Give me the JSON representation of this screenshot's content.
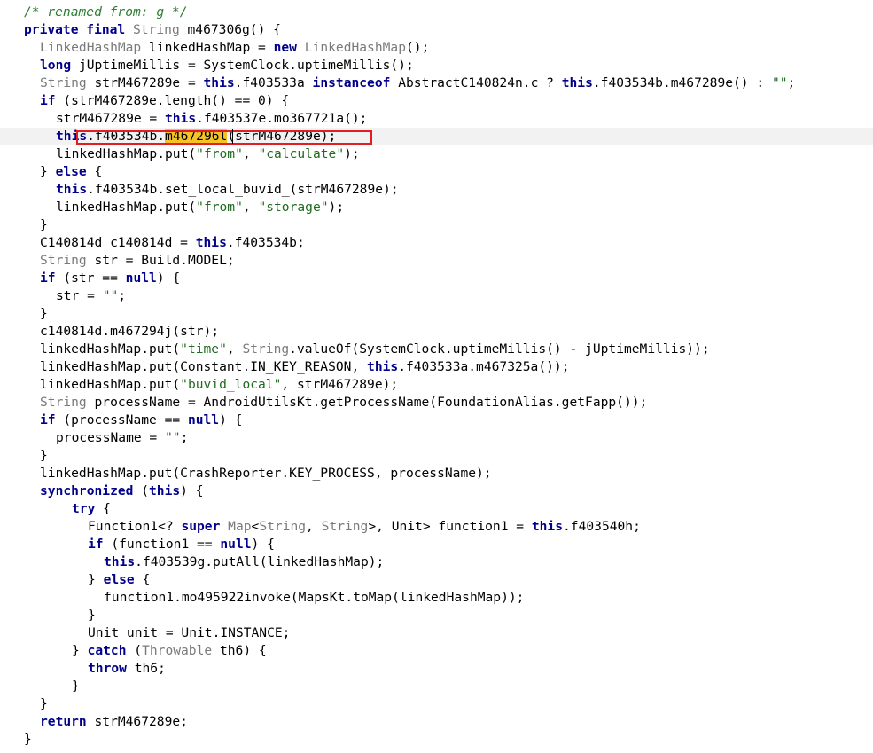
{
  "editor": {
    "selected_line": 7,
    "highlight_token": "m467296l",
    "lines": [
      {
        "indent": 2,
        "tokens": [
          [
            "cm",
            "/* renamed from: g */"
          ]
        ]
      },
      {
        "indent": 2,
        "tokens": [
          [
            "kw",
            "private final "
          ],
          [
            "ty",
            "String"
          ],
          [
            "",
            " m467306g() {"
          ]
        ]
      },
      {
        "indent": 4,
        "tokens": [
          [
            "ty",
            "LinkedHashMap"
          ],
          [
            "",
            " linkedHashMap = "
          ],
          [
            "kw",
            "new "
          ],
          [
            "ty",
            "LinkedHashMap"
          ],
          [
            "",
            "();"
          ]
        ]
      },
      {
        "indent": 4,
        "tokens": [
          [
            "kw",
            "long"
          ],
          [
            "",
            " jUptimeMillis = SystemClock.uptimeMillis();"
          ]
        ]
      },
      {
        "indent": 4,
        "tokens": [
          [
            "ty",
            "String"
          ],
          [
            "",
            " strM467289e = "
          ],
          [
            "kw",
            "this"
          ],
          [
            "",
            ".f403533a "
          ],
          [
            "kw",
            "instanceof"
          ],
          [
            "",
            " AbstractC140824n.c ? "
          ],
          [
            "kw",
            "this"
          ],
          [
            "",
            ".f403534b.m467289e() : "
          ],
          [
            "st",
            "\"\""
          ],
          [
            "",
            ";"
          ]
        ]
      },
      {
        "indent": 4,
        "tokens": [
          [
            "kw",
            "if"
          ],
          [
            "",
            " (strM467289e.length() == 0) {"
          ]
        ]
      },
      {
        "indent": 6,
        "tokens": [
          [
            "",
            "strM467289e = "
          ],
          [
            "kw",
            "this"
          ],
          [
            "",
            ".f403537e.mo367721a();"
          ]
        ]
      },
      {
        "indent": 6,
        "tokens": [
          [
            "kw",
            "this"
          ],
          [
            "",
            ".f403534b."
          ],
          [
            "hl",
            "m467296l"
          ],
          [
            "",
            "(strM467289e);"
          ]
        ]
      },
      {
        "indent": 6,
        "tokens": [
          [
            "",
            "linkedHashMap.put("
          ],
          [
            "st",
            "\"from\""
          ],
          [
            "",
            ", "
          ],
          [
            "st",
            "\"calculate\""
          ],
          [
            "",
            ");"
          ]
        ]
      },
      {
        "indent": 4,
        "tokens": [
          [
            "",
            "} "
          ],
          [
            "kw",
            "else"
          ],
          [
            "",
            " {"
          ]
        ]
      },
      {
        "indent": 6,
        "tokens": [
          [
            "kw",
            "this"
          ],
          [
            "",
            ".f403534b.set_local_buvid_(strM467289e);"
          ]
        ]
      },
      {
        "indent": 6,
        "tokens": [
          [
            "",
            "linkedHashMap.put("
          ],
          [
            "st",
            "\"from\""
          ],
          [
            "",
            ", "
          ],
          [
            "st",
            "\"storage\""
          ],
          [
            "",
            ");"
          ]
        ]
      },
      {
        "indent": 4,
        "tokens": [
          [
            "",
            "}"
          ]
        ]
      },
      {
        "indent": 4,
        "tokens": [
          [
            "",
            "C140814d c140814d = "
          ],
          [
            "kw",
            "this"
          ],
          [
            "",
            ".f403534b;"
          ]
        ]
      },
      {
        "indent": 4,
        "tokens": [
          [
            "ty",
            "String"
          ],
          [
            "",
            " str = Build.MODEL;"
          ]
        ]
      },
      {
        "indent": 4,
        "tokens": [
          [
            "kw",
            "if"
          ],
          [
            "",
            " (str == "
          ],
          [
            "kw",
            "null"
          ],
          [
            "",
            ") {"
          ]
        ]
      },
      {
        "indent": 6,
        "tokens": [
          [
            "",
            "str = "
          ],
          [
            "st",
            "\"\""
          ],
          [
            "",
            ";"
          ]
        ]
      },
      {
        "indent": 4,
        "tokens": [
          [
            "",
            "}"
          ]
        ]
      },
      {
        "indent": 4,
        "tokens": [
          [
            "",
            "c140814d.m467294j(str);"
          ]
        ]
      },
      {
        "indent": 4,
        "tokens": [
          [
            "",
            "linkedHashMap.put("
          ],
          [
            "st",
            "\"time\""
          ],
          [
            "",
            ", "
          ],
          [
            "ty",
            "String"
          ],
          [
            "",
            ".valueOf(SystemClock.uptimeMillis() - jUptimeMillis));"
          ]
        ]
      },
      {
        "indent": 4,
        "tokens": [
          [
            "",
            "linkedHashMap.put(Constant.IN_KEY_REASON, "
          ],
          [
            "kw",
            "this"
          ],
          [
            "",
            ".f403533a.m467325a());"
          ]
        ]
      },
      {
        "indent": 4,
        "tokens": [
          [
            "",
            "linkedHashMap.put("
          ],
          [
            "st",
            "\"buvid_local\""
          ],
          [
            "",
            ", strM467289e);"
          ]
        ]
      },
      {
        "indent": 4,
        "tokens": [
          [
            "ty",
            "String"
          ],
          [
            "",
            " processName = AndroidUtilsKt.getProcessName(FoundationAlias.getFapp());"
          ]
        ]
      },
      {
        "indent": 4,
        "tokens": [
          [
            "kw",
            "if"
          ],
          [
            "",
            " (processName == "
          ],
          [
            "kw",
            "null"
          ],
          [
            "",
            ") {"
          ]
        ]
      },
      {
        "indent": 6,
        "tokens": [
          [
            "",
            "processName = "
          ],
          [
            "st",
            "\"\""
          ],
          [
            "",
            ";"
          ]
        ]
      },
      {
        "indent": 4,
        "tokens": [
          [
            "",
            "}"
          ]
        ]
      },
      {
        "indent": 4,
        "tokens": [
          [
            "",
            "linkedHashMap.put(CrashReporter.KEY_PROCESS, processName);"
          ]
        ]
      },
      {
        "indent": 4,
        "tokens": [
          [
            "kw",
            "synchronized"
          ],
          [
            "",
            " ("
          ],
          [
            "kw",
            "this"
          ],
          [
            "",
            ") {"
          ]
        ]
      },
      {
        "indent": 8,
        "tokens": [
          [
            "kw",
            "try"
          ],
          [
            "",
            " {"
          ]
        ]
      },
      {
        "indent": 10,
        "tokens": [
          [
            "",
            "Function1<? "
          ],
          [
            "kw",
            "super"
          ],
          [
            "",
            " "
          ],
          [
            "ty",
            "Map"
          ],
          [
            "",
            "<"
          ],
          [
            "ty",
            "String"
          ],
          [
            "",
            ", "
          ],
          [
            "ty",
            "String"
          ],
          [
            "",
            ">, Unit> function1 = "
          ],
          [
            "kw",
            "this"
          ],
          [
            "",
            ".f403540h;"
          ]
        ]
      },
      {
        "indent": 10,
        "tokens": [
          [
            "kw",
            "if"
          ],
          [
            "",
            " (function1 == "
          ],
          [
            "kw",
            "null"
          ],
          [
            "",
            ") {"
          ]
        ]
      },
      {
        "indent": 12,
        "tokens": [
          [
            "kw",
            "this"
          ],
          [
            "",
            ".f403539g.putAll(linkedHashMap);"
          ]
        ]
      },
      {
        "indent": 10,
        "tokens": [
          [
            "",
            "} "
          ],
          [
            "kw",
            "else"
          ],
          [
            "",
            " {"
          ]
        ]
      },
      {
        "indent": 12,
        "tokens": [
          [
            "",
            "function1.mo495922invoke(MapsKt.toMap(linkedHashMap));"
          ]
        ]
      },
      {
        "indent": 10,
        "tokens": [
          [
            "",
            "}"
          ]
        ]
      },
      {
        "indent": 10,
        "tokens": [
          [
            "",
            "Unit unit = Unit.INSTANCE;"
          ]
        ]
      },
      {
        "indent": 8,
        "tokens": [
          [
            "",
            "} "
          ],
          [
            "kw",
            "catch"
          ],
          [
            "",
            " ("
          ],
          [
            "ty",
            "Throwable"
          ],
          [
            "",
            " th6) {"
          ]
        ]
      },
      {
        "indent": 10,
        "tokens": [
          [
            "kw",
            "throw"
          ],
          [
            "",
            " th6;"
          ]
        ]
      },
      {
        "indent": 8,
        "tokens": [
          [
            "",
            "}"
          ]
        ]
      },
      {
        "indent": 4,
        "tokens": [
          [
            "",
            "}"
          ]
        ]
      },
      {
        "indent": 4,
        "tokens": [
          [
            "kw",
            "return"
          ],
          [
            "",
            " strM467289e;"
          ]
        ]
      },
      {
        "indent": 2,
        "tokens": [
          [
            "",
            "}"
          ]
        ]
      }
    ]
  }
}
